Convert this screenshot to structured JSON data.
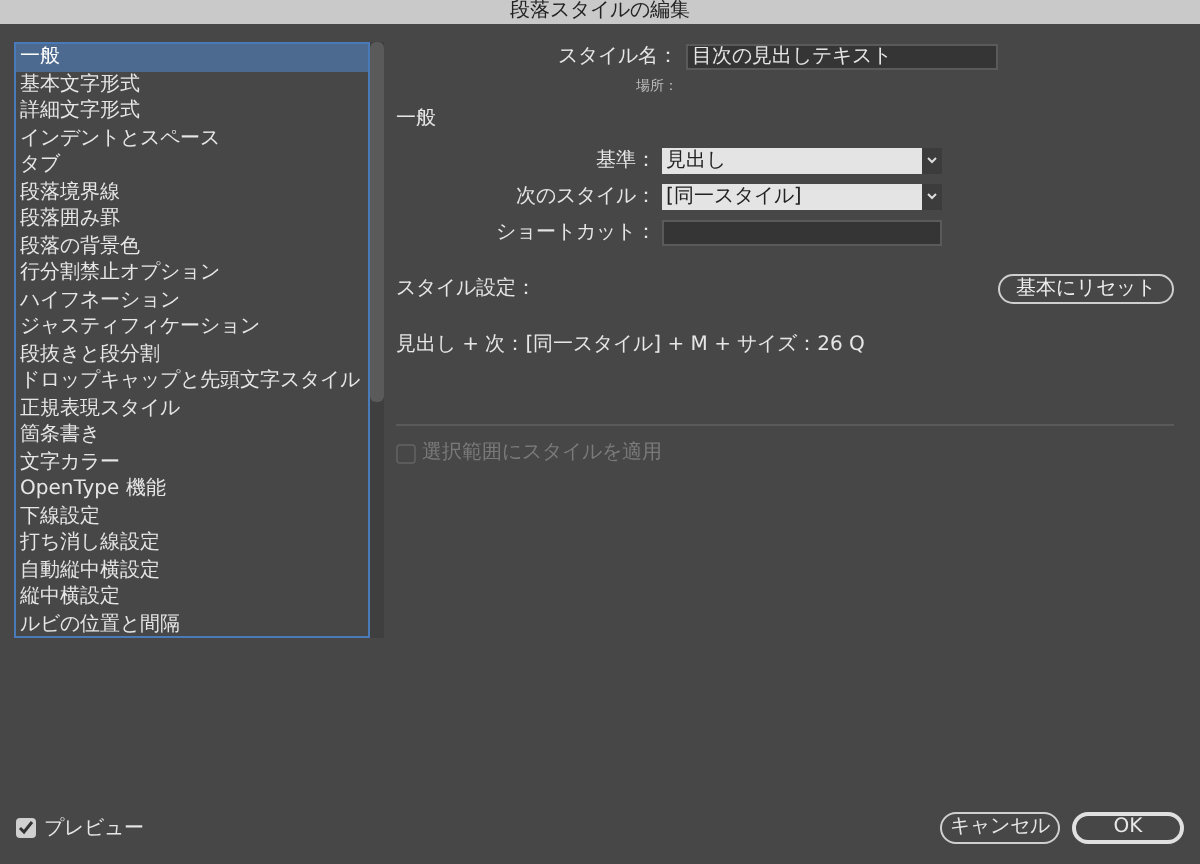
{
  "window": {
    "title": "段落スタイルの編集"
  },
  "sidebar": {
    "items": [
      {
        "label": "一般",
        "selected": true
      },
      {
        "label": "基本文字形式",
        "selected": false
      },
      {
        "label": "詳細文字形式",
        "selected": false
      },
      {
        "label": "インデントとスペース",
        "selected": false
      },
      {
        "label": "タブ",
        "selected": false
      },
      {
        "label": "段落境界線",
        "selected": false
      },
      {
        "label": "段落囲み罫",
        "selected": false
      },
      {
        "label": "段落の背景色",
        "selected": false
      },
      {
        "label": "行分割禁止オプション",
        "selected": false
      },
      {
        "label": "ハイフネーション",
        "selected": false
      },
      {
        "label": "ジャスティフィケーション",
        "selected": false
      },
      {
        "label": "段抜きと段分割",
        "selected": false
      },
      {
        "label": "ドロップキャップと先頭文字スタイル",
        "selected": false
      },
      {
        "label": "正規表現スタイル",
        "selected": false
      },
      {
        "label": "箇条書き",
        "selected": false
      },
      {
        "label": "文字カラー",
        "selected": false
      },
      {
        "label": "OpenType 機能",
        "selected": false
      },
      {
        "label": "下線設定",
        "selected": false
      },
      {
        "label": "打ち消し線設定",
        "selected": false
      },
      {
        "label": "自動縦中横設定",
        "selected": false
      },
      {
        "label": "縦中横設定",
        "selected": false
      },
      {
        "label": "ルビの位置と間隔",
        "selected": false
      }
    ]
  },
  "style_name": {
    "label": "スタイル名：",
    "value": "目次の見出しテキスト"
  },
  "location": {
    "label": "場所："
  },
  "section_title": "一般",
  "fields": [
    {
      "kind": "dropdown",
      "label": "基準：",
      "value": "見出し"
    },
    {
      "kind": "dropdown",
      "label": "次のスタイル：",
      "value": "[同一スタイル]"
    },
    {
      "kind": "text",
      "label": "ショートカット："
    }
  ],
  "style_settings": {
    "label": "スタイル設定：",
    "reset_button": "基本にリセット",
    "summary": "見出し + 次：[同一スタイル] + M + サイズ：26 Q"
  },
  "apply_to_selection": {
    "label": "選択範囲にスタイルを適用",
    "checked": false,
    "disabled": true
  },
  "preview": {
    "label": "プレビュー",
    "checked": true
  },
  "buttons": {
    "cancel": "キャンセル",
    "ok": "OK"
  }
}
